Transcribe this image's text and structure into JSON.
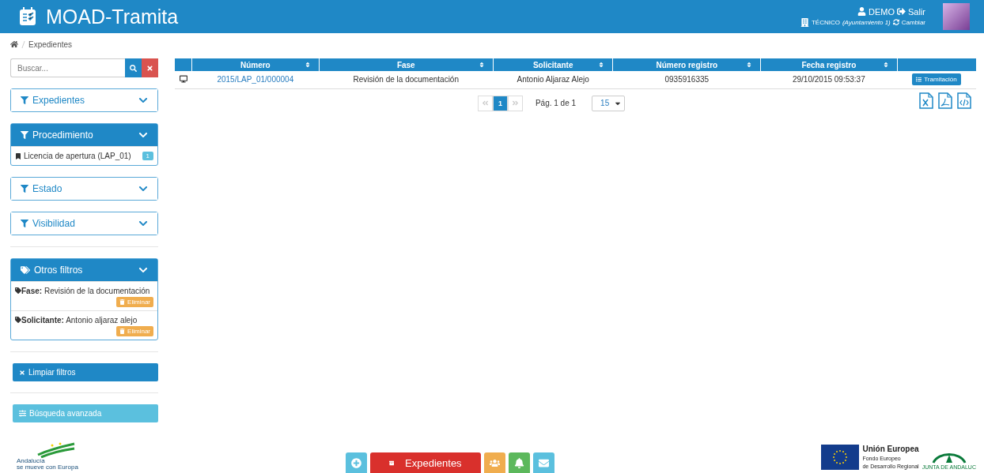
{
  "header": {
    "title": "MOAD-Tramita",
    "user": "DEMO",
    "logout": "Salir",
    "role": "TÉCNICO",
    "organization": "(Ayuntamiento 1)",
    "switch": "Cambiar"
  },
  "breadcrumb": [
    "Expedientes"
  ],
  "search": {
    "placeholder": "Buscar..."
  },
  "filters": [
    {
      "kind": "filter",
      "label": "Expedientes",
      "expanded": false
    },
    {
      "kind": "filter",
      "label": "Procedimiento",
      "expanded": true,
      "items": [
        {
          "label": "Licencia de apertura (LAP_01)",
          "count": "1"
        }
      ]
    },
    {
      "kind": "filter",
      "label": "Estado",
      "expanded": false
    },
    {
      "kind": "filter",
      "label": "Visibilidad",
      "expanded": false
    },
    {
      "kind": "tags",
      "label": "Otros filtros",
      "expanded": true,
      "items": [
        {
          "label": "**Fase:** Revisión de la documentación",
          "action": "Eliminar"
        },
        {
          "label": "**Solicitante:** Antonio aljaraz alejo",
          "action": "Eliminar"
        }
      ]
    }
  ],
  "clear_button": "Limpiar filtros",
  "advanced_button": "Búsqueda avanzada",
  "table": {
    "columns": [
      "Número",
      "Fase",
      "Solicitante",
      "Número registro",
      "Fecha registro"
    ],
    "rows": [
      {
        "cells": [
          "2015/LAP_01/000004",
          "Revisión de la documentación",
          "Antonio Aljaraz Alejo",
          "0935916335",
          "29/10/2015 09:53:37"
        ],
        "action": "Tramitación"
      }
    ]
  },
  "pagination": {
    "pages": [
      {
        "label": "1",
        "selected": true
      }
    ],
    "info": "Pág. 1 de 1",
    "page_size": "15"
  },
  "toolbar": [
    {
      "kind": "plus",
      "color": "#5bc0de"
    },
    {
      "kind": "text",
      "label": "Expedientes",
      "color": "#d9302c"
    },
    {
      "kind": "users",
      "color": "#f0ad4e"
    },
    {
      "kind": "bell",
      "color": "#5cb85c"
    },
    {
      "kind": "mail",
      "color": "#5bc0de"
    }
  ],
  "footer": {
    "left_logo": [
      "Andalucía",
      "se mueve con Europa"
    ],
    "eu_title": "Unión Europea",
    "eu_fund": [
      "Fondo Europeo",
      "de Desarrollo Regional"
    ],
    "junta": "JUNTA DE ANDALUC"
  }
}
